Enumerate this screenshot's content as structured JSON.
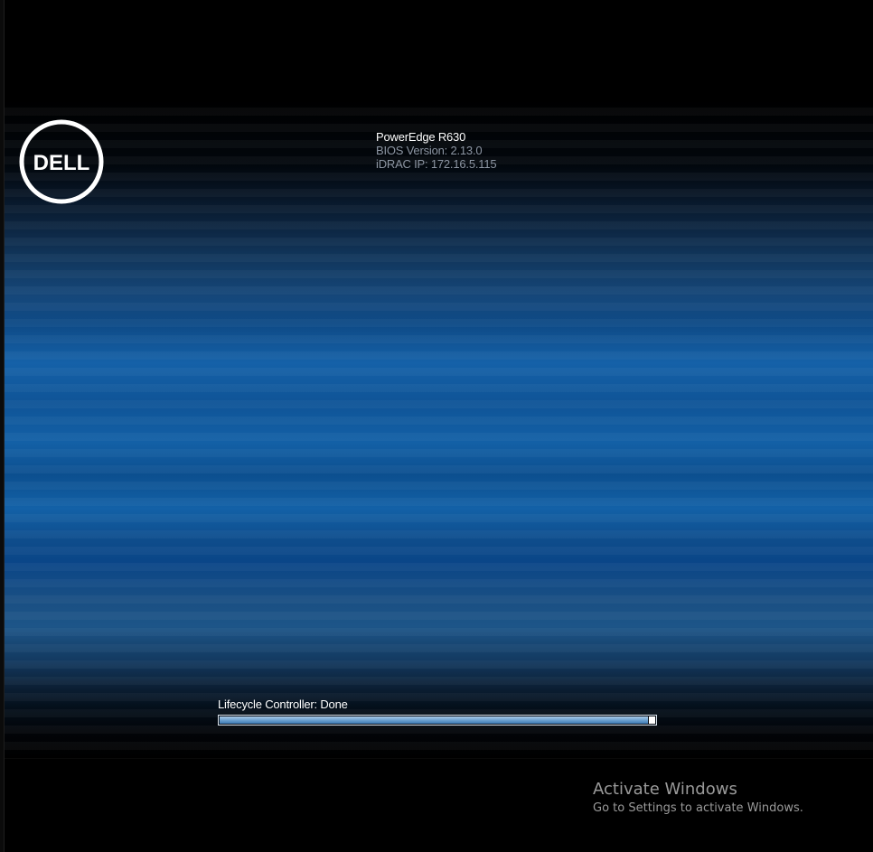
{
  "boot_screen": {
    "logo_text": "DELL",
    "system_model": "PowerEdge R630",
    "bios_version": "BIOS Version: 2.13.0",
    "idrac_ip": "iDRAC IP:  172.16.5.115",
    "lifecycle_status": "Lifecycle Controller: Done",
    "progress_fraction": 1.0
  },
  "watermark": {
    "title": "Activate Windows",
    "subtitle": "Go to Settings to activate Windows."
  },
  "colors": {
    "background": "#000000",
    "band_blue": "#1361a7",
    "secondary_text": "#8d96a3",
    "watermark_text": "#9a9a9a"
  }
}
